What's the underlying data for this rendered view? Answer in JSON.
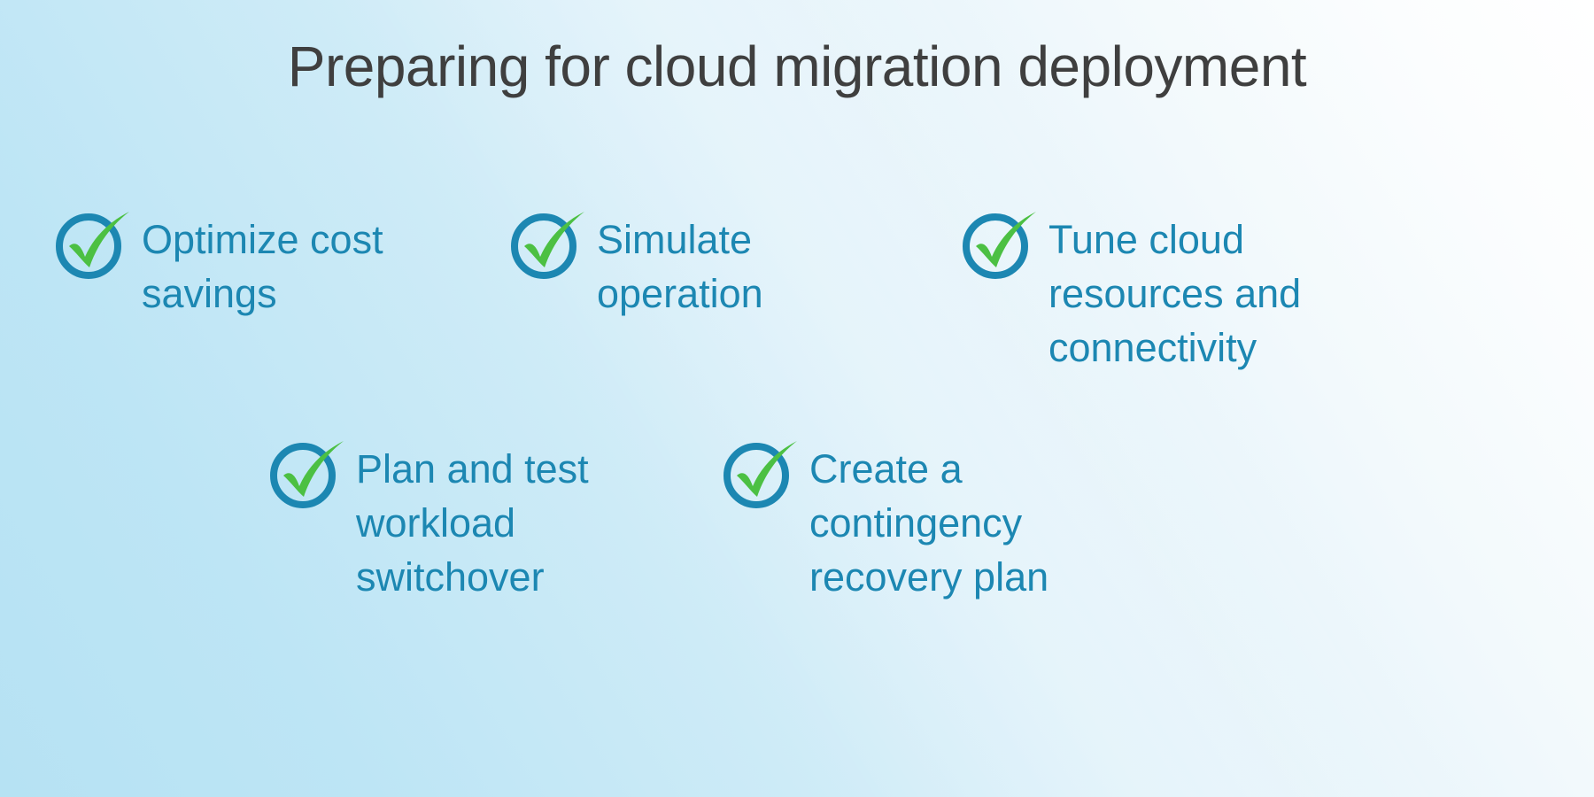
{
  "slide": {
    "title": "Preparing for cloud migration deployment",
    "title_color": "#3f3f3f",
    "background_from": "#b6e2f3",
    "background_to": "#ffffff",
    "accent_text_color": "#1c87b2",
    "check_ring_color": "#1c87b2",
    "check_mark_color": "#4cc043"
  },
  "items": [
    {
      "icon": "check-circle-icon",
      "label": "Optimize cost savings"
    },
    {
      "icon": "check-circle-icon",
      "label": "Simulate operation"
    },
    {
      "icon": "check-circle-icon",
      "label": "Tune cloud resources and connectivity"
    },
    {
      "icon": "check-circle-icon",
      "label": "Plan and test workload switchover"
    },
    {
      "icon": "check-circle-icon",
      "label": "Create a contingency recovery plan"
    }
  ]
}
